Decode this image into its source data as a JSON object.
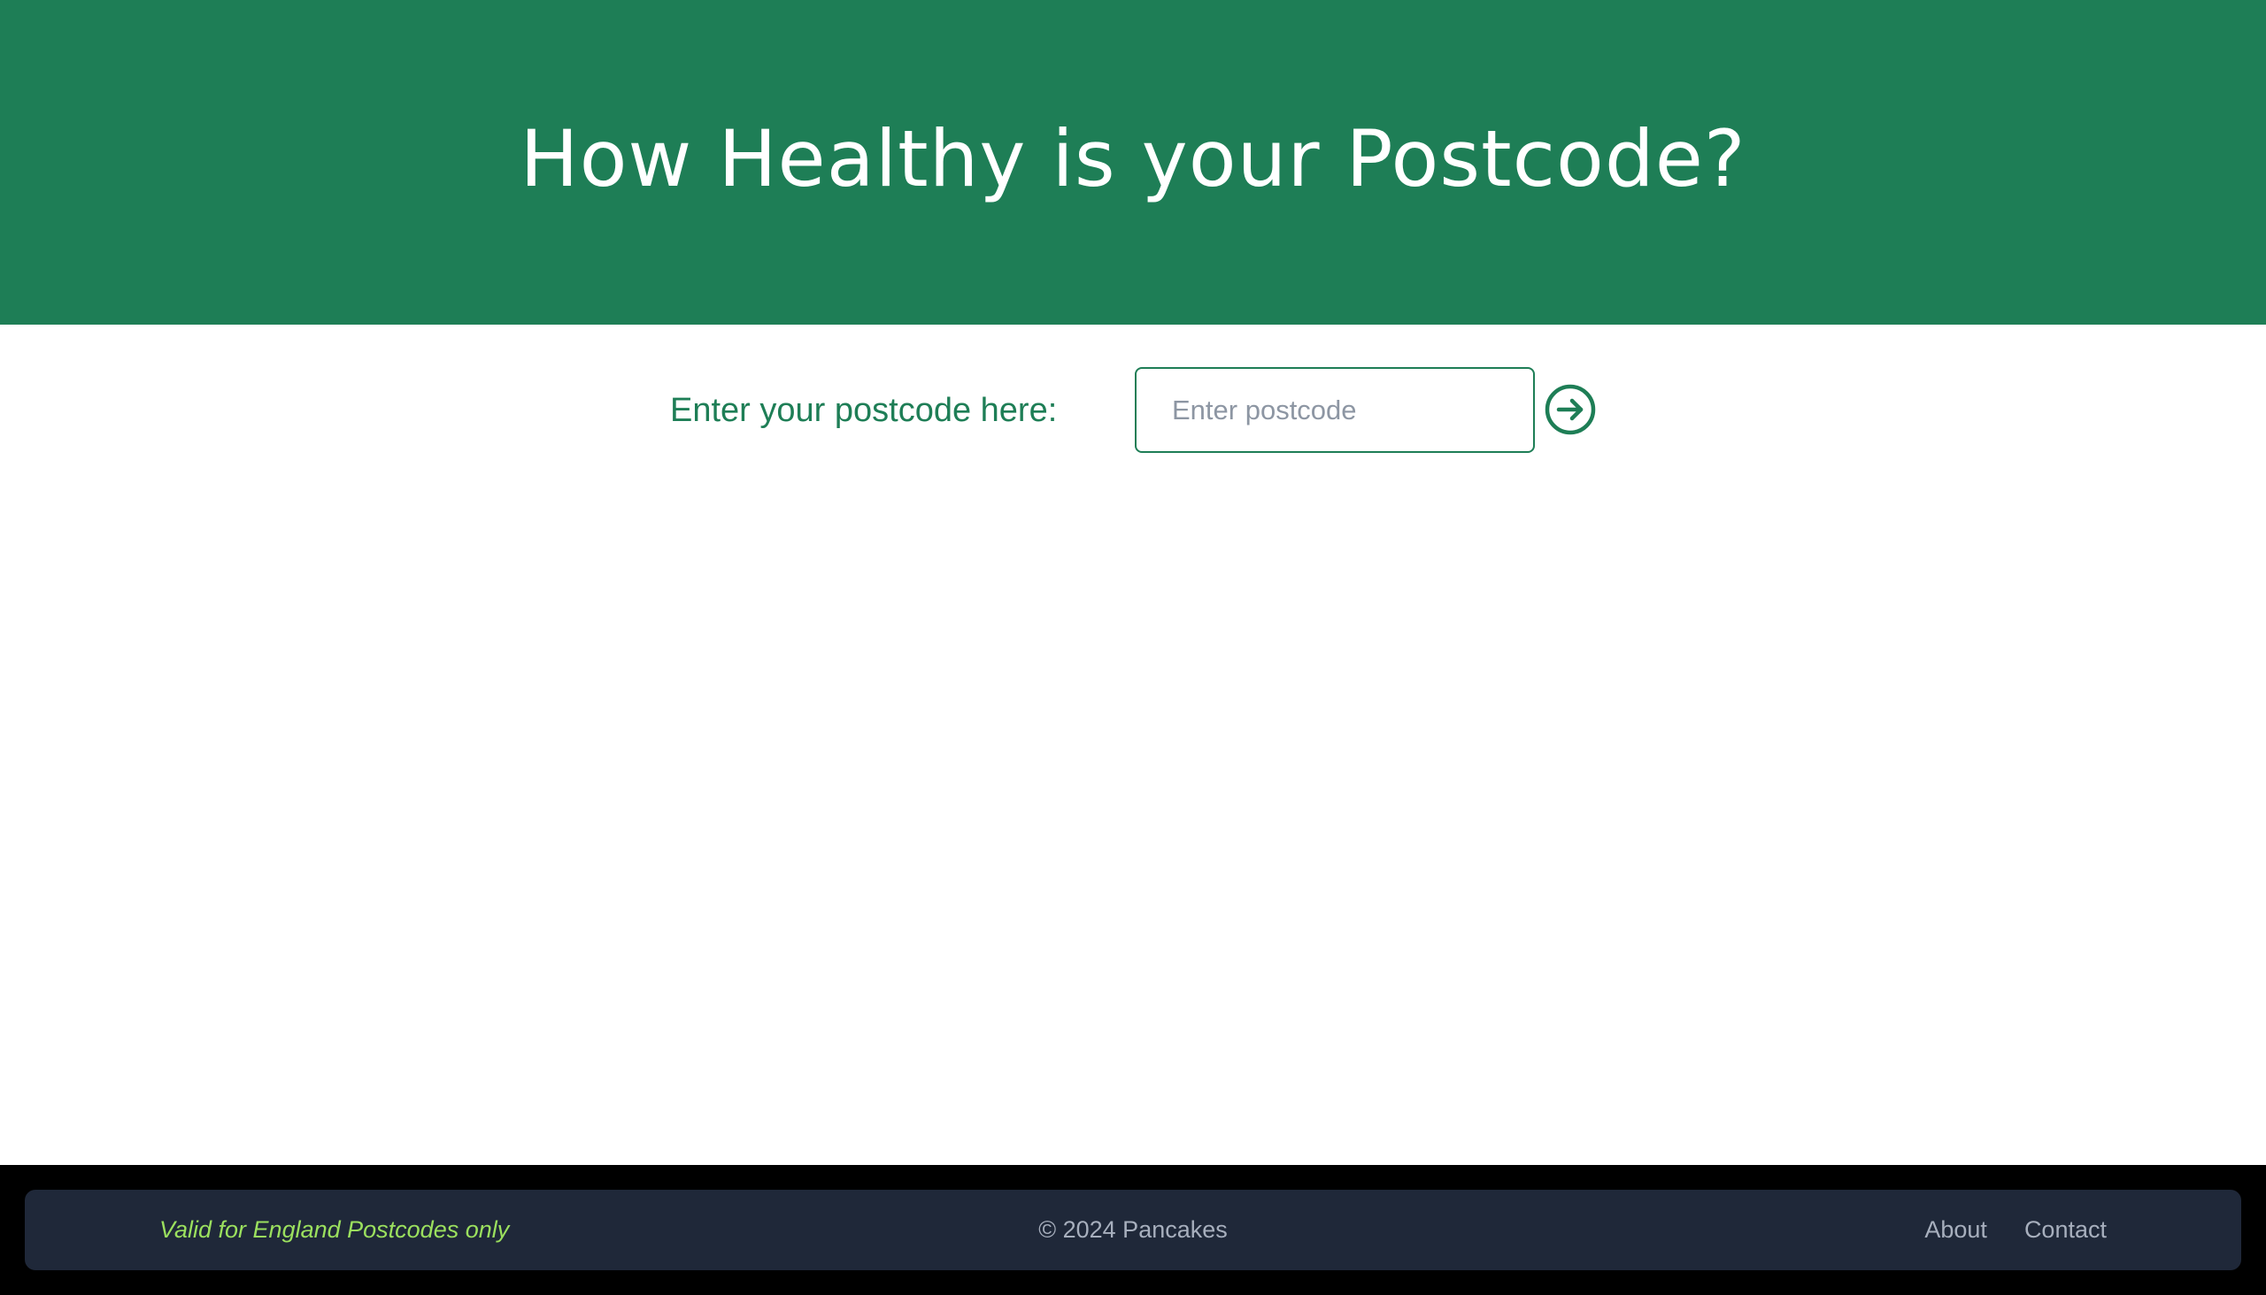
{
  "header": {
    "title": "How Healthy is your Postcode?"
  },
  "form": {
    "label": "Enter your postcode here:",
    "input_value": "",
    "input_placeholder": "Enter postcode",
    "submit_icon": "arrow-right-circle-icon"
  },
  "footer": {
    "note": "Valid for England Postcodes only",
    "copyright": "© 2024 Pancakes",
    "links": [
      {
        "label": "About"
      },
      {
        "label": "Contact"
      }
    ]
  },
  "colors": {
    "brand_green": "#1e7e56",
    "footer_bg": "#1f2839",
    "footer_note": "#9be05e",
    "footer_text": "#a7afbd"
  }
}
